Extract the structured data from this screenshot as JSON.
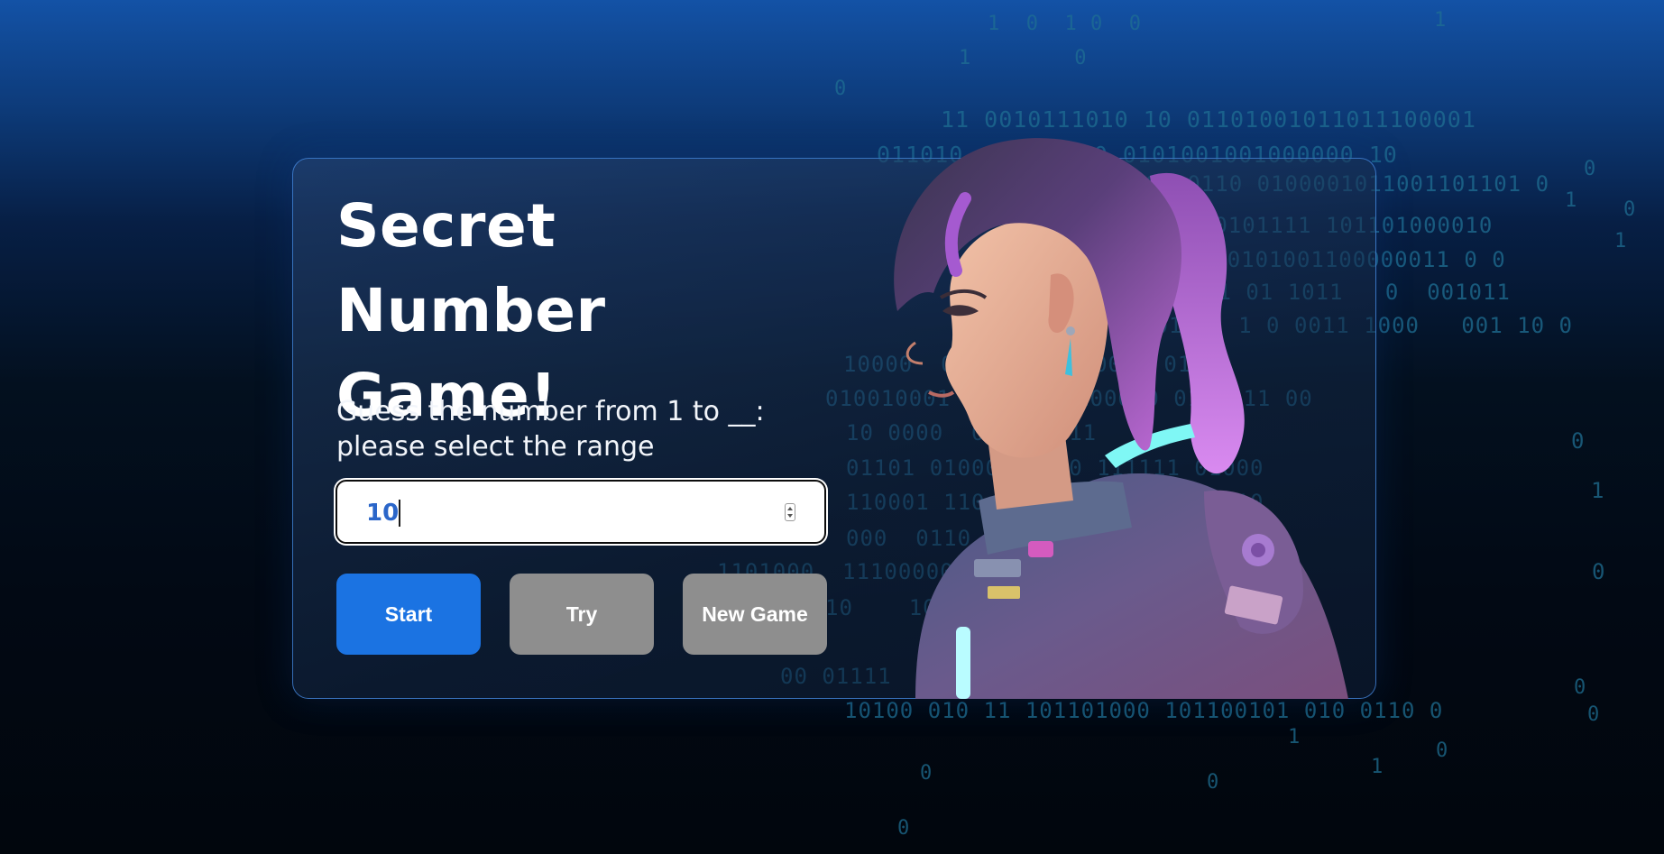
{
  "game": {
    "title": "Secret Number Game!",
    "prompt": "Guess the number from 1 to __: please select the range",
    "range_input_value": "10"
  },
  "buttons": {
    "start_label": "Start",
    "try_label": "Try",
    "new_game_label": "New Game"
  },
  "colors": {
    "start_button": "#1b73e2",
    "disabled_button": "#8e8e8e",
    "card_border": "#468ce6",
    "input_text": "#2b66c9",
    "binary_text": "#1f6f93"
  },
  "decor": {
    "binary_rain": [
      "1  0  1 0  0",
      "1        0",
      "0",
      "11 0010111010 10 01101001011011100001",
      "011010     1 000 0101001001000000 10",
      "0 10110 0100001011001101101 0",
      "0010101111 101101000010",
      "0110  0101001100000011 0 0",
      "01 01 1011   0  001011",
      "0010 1 1 0 0011 1000   001 10 0",
      "10000  0110 0110100001 01101",
      "010010001  0011110100000 0100011 00",
      "10 0000  001110111",
      "01101 01000 0 010 111111 01000",
      "110001 110  000100001101000110",
      "000  0110  1000010111000 1010",
      "1101000  11100000 1000 0 11 1 0 11 10",
      "10    1010001000111110100011 0",
      "00 01111     0 0101 11011",
      "10100 010 11 101101000 101100101 010 0110 0"
    ],
    "character_image": "illustrated girl with purple ponytail in space suit"
  }
}
